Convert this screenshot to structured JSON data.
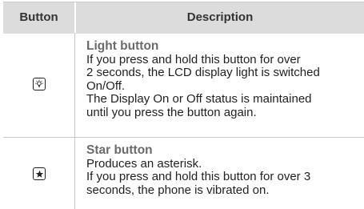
{
  "table": {
    "headers": {
      "button": "Button",
      "description": "Description"
    },
    "rows": [
      {
        "icon": "light-bulb-icon",
        "title": "Light button",
        "lines": [
          "If you press and hold this button for over",
          "2 seconds, the LCD display light is switched",
          "On/Off.",
          "The Display On or Off status is maintained",
          "until you press the button again."
        ]
      },
      {
        "icon": "star-icon",
        "title": "Star button",
        "lines": [
          "Produces an asterisk.",
          "If you press and hold this button for over 3",
          "seconds, the phone is vibrated on."
        ]
      }
    ]
  }
}
